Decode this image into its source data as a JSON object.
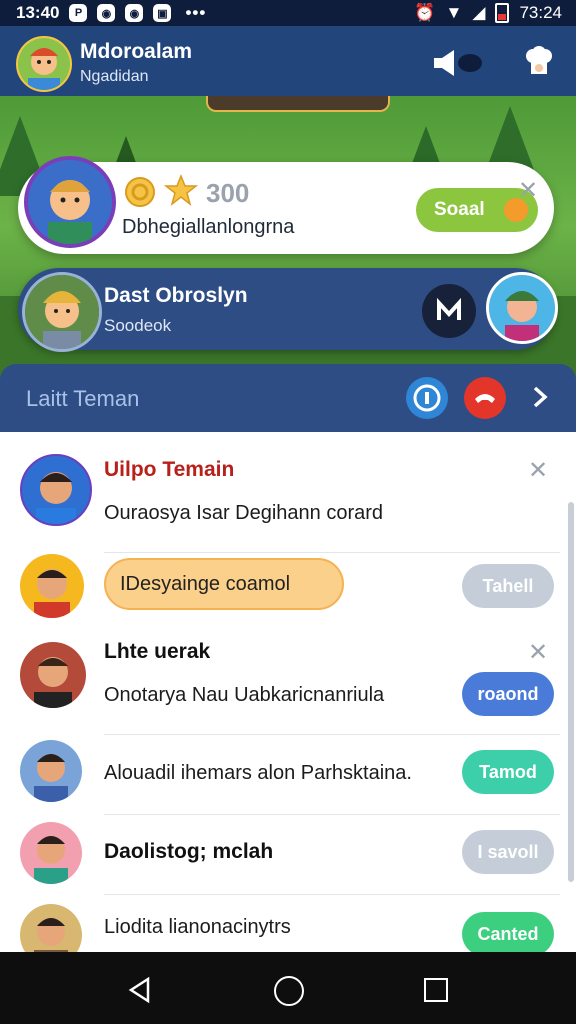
{
  "status_bar": {
    "time": "13:40",
    "right_time": "73:24"
  },
  "header": {
    "name": "Mdoroalam",
    "subtitle": "Ngadidan"
  },
  "quest_card": {
    "score": "300",
    "text": "Dbhegiallanlongrna",
    "send_label": "Soaal"
  },
  "player_card": {
    "name": "Dast Obroslyn",
    "sub": "Soodeok"
  },
  "friends": {
    "title": "Laitt Teman",
    "items": [
      {
        "name": "Uilpo Temain",
        "message": "Ouraosya Isar Degihann corard"
      },
      {
        "pill": "IDesyainge coamol",
        "button": "Tahell"
      },
      {
        "name": "Lhte uerak",
        "message": "Onotarya Nau Uabkaricnanriula",
        "button": "roaond"
      },
      {
        "message": "Alouadil ihemars alon Parhsktaina.",
        "button": "Tamod"
      },
      {
        "name": "Daolistog; mclah",
        "button": "I savoll"
      },
      {
        "name": "Liodita lianonacinytrs",
        "button": "Canted"
      }
    ]
  },
  "colors": {
    "accent_blue": "#4a7bd8",
    "accent_teal": "#3ccfa9",
    "accent_green": "#3ccf7f",
    "muted_gray": "#c4cdd8"
  }
}
